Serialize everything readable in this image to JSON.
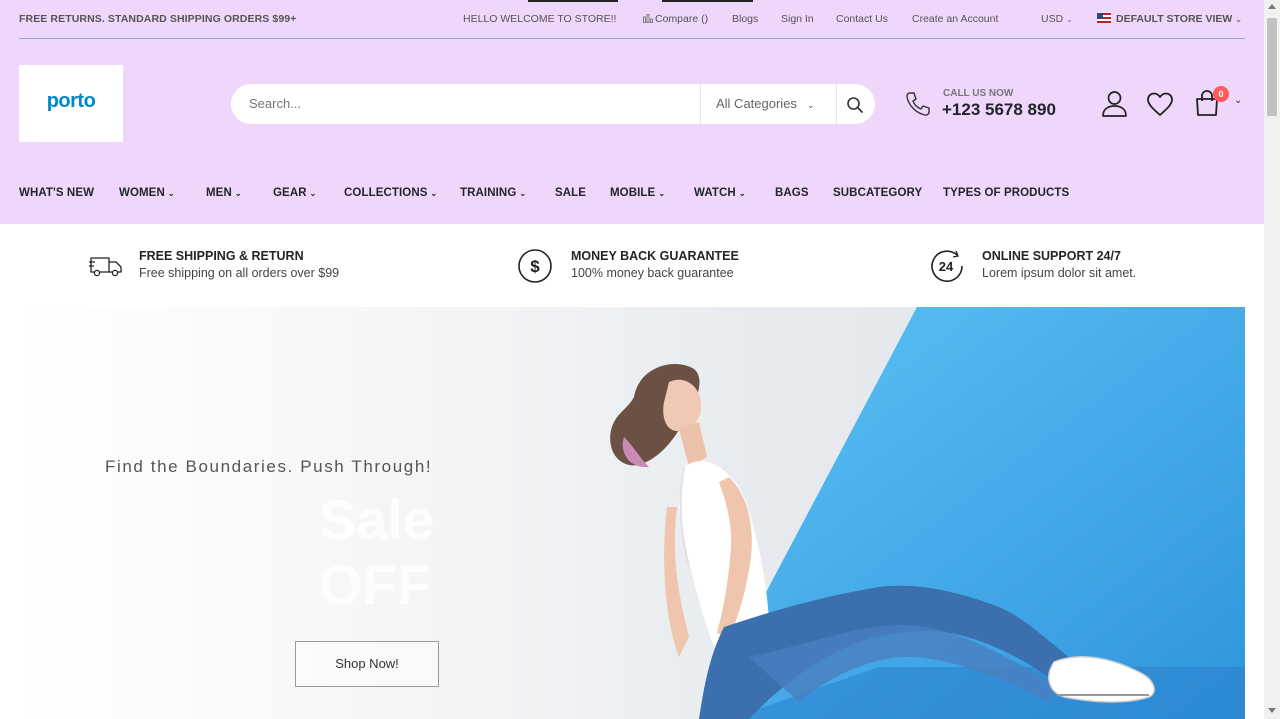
{
  "topbar": {
    "promo": "FREE RETURNS. STANDARD SHIPPING ORDERS $99+",
    "welcome": "HELLO WELCOME TO STORE!!",
    "compare": "Compare ()",
    "blogs": "Blogs",
    "sign_in": "Sign In",
    "contact": "Contact Us",
    "create_account": "Create an Account",
    "currency": "USD",
    "store_view": "DEFAULT STORE VIEW"
  },
  "logo": {
    "text": "porto"
  },
  "search": {
    "placeholder": "Search...",
    "category": "All Categories"
  },
  "call": {
    "label": "CALL US NOW",
    "number": "+123 5678 890"
  },
  "cart": {
    "count": "0"
  },
  "nav": {
    "items": [
      {
        "label": "WHAT'S NEW"
      },
      {
        "label": "WOMEN"
      },
      {
        "label": "MEN"
      },
      {
        "label": "GEAR"
      },
      {
        "label": "COLLECTIONS"
      },
      {
        "label": "TRAINING"
      },
      {
        "label": "SALE"
      },
      {
        "label": "MOBILE"
      },
      {
        "label": "WATCH"
      },
      {
        "label": "BAGS"
      },
      {
        "label": "SUBCATEGORY"
      },
      {
        "label": "TYPES OF PRODUCTS"
      }
    ]
  },
  "info": [
    {
      "icon": "truck-icon",
      "title": "FREE SHIPPING & RETURN",
      "desc": "Free shipping on all orders over $99"
    },
    {
      "icon": "dollar-icon",
      "title": "MONEY BACK GUARANTEE",
      "desc": "100% money back guarantee"
    },
    {
      "icon": "support-24-icon",
      "title": "ONLINE SUPPORT 24/7",
      "desc": "Lorem ipsum dolor sit amet."
    }
  ],
  "hero": {
    "subtitle": "Find the Boundaries. Push Through!",
    "ghost_line1": "Sale",
    "ghost_line2": "OFF",
    "button": "Shop Now!"
  },
  "colors": {
    "header_bg": "#efd6fb",
    "accent": "#0088cc",
    "badge": "#ff5b5b",
    "hero_blue": "#3fa9ea"
  }
}
